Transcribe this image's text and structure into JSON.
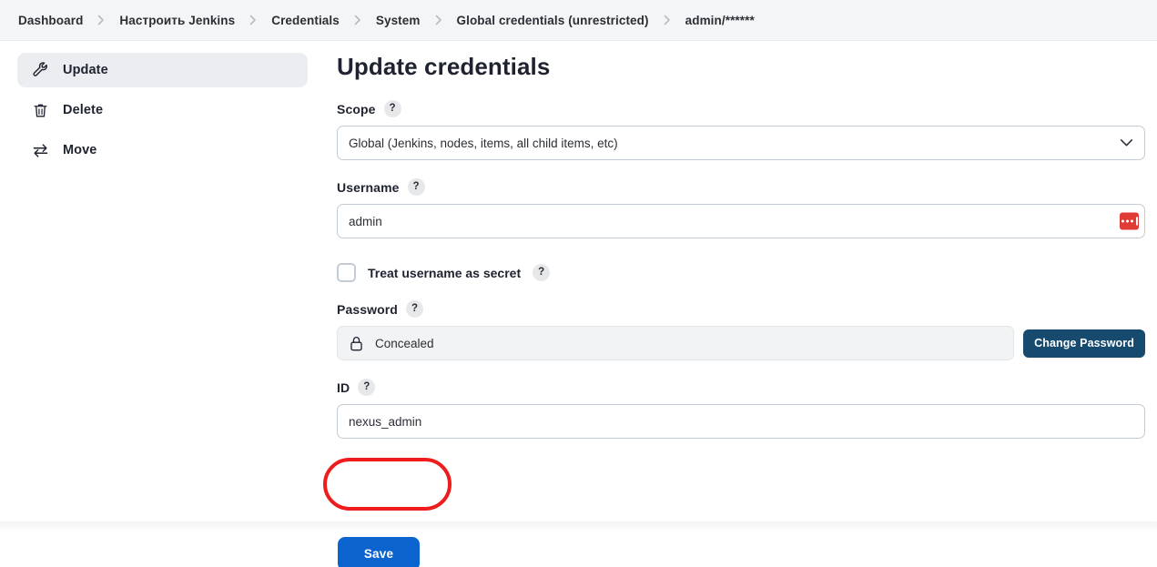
{
  "breadcrumb": {
    "items": [
      {
        "label": "Dashboard"
      },
      {
        "label": "Настроить Jenkins"
      },
      {
        "label": "Credentials"
      },
      {
        "label": "System"
      },
      {
        "label": "Global credentials (unrestricted)"
      },
      {
        "label": "admin/******"
      }
    ],
    "separator_icon": "chevron-right-icon"
  },
  "sidebar": {
    "items": [
      {
        "label": "Update",
        "icon": "wrench-icon",
        "active": true
      },
      {
        "label": "Delete",
        "icon": "trash-icon",
        "active": false
      },
      {
        "label": "Move",
        "icon": "transfer-arrows-icon",
        "active": false
      }
    ]
  },
  "main": {
    "title": "Update credentials",
    "help_badge": "?",
    "scope": {
      "label": "Scope",
      "value": "Global (Jenkins, nodes, items, all child items, etc)",
      "chevron_icon": "chevron-down-icon"
    },
    "username": {
      "label": "Username",
      "value": "admin",
      "placeholder": "",
      "password_manager_icon": "password-manager-icon"
    },
    "treat_as_secret": {
      "label": "Treat username as secret",
      "checked": false
    },
    "password": {
      "label": "Password",
      "value": "Concealed",
      "lock_icon": "lock-icon",
      "change_button": "Change Password"
    },
    "id": {
      "label": "ID",
      "value": "nexus_admin",
      "placeholder": ""
    },
    "save_button": "Save"
  },
  "annotation": {
    "type": "red-rounded-rect-highlight",
    "target": "id-input"
  },
  "colors": {
    "accent_blue": "#0b63ce",
    "navy_button": "#164a6f",
    "annotation_red": "#ee1c1c",
    "pwmgr_red": "#e03b35",
    "page_bg": "#ffffff",
    "bar_bg": "#f4f5f6",
    "field_border": "#c3ccd4"
  }
}
